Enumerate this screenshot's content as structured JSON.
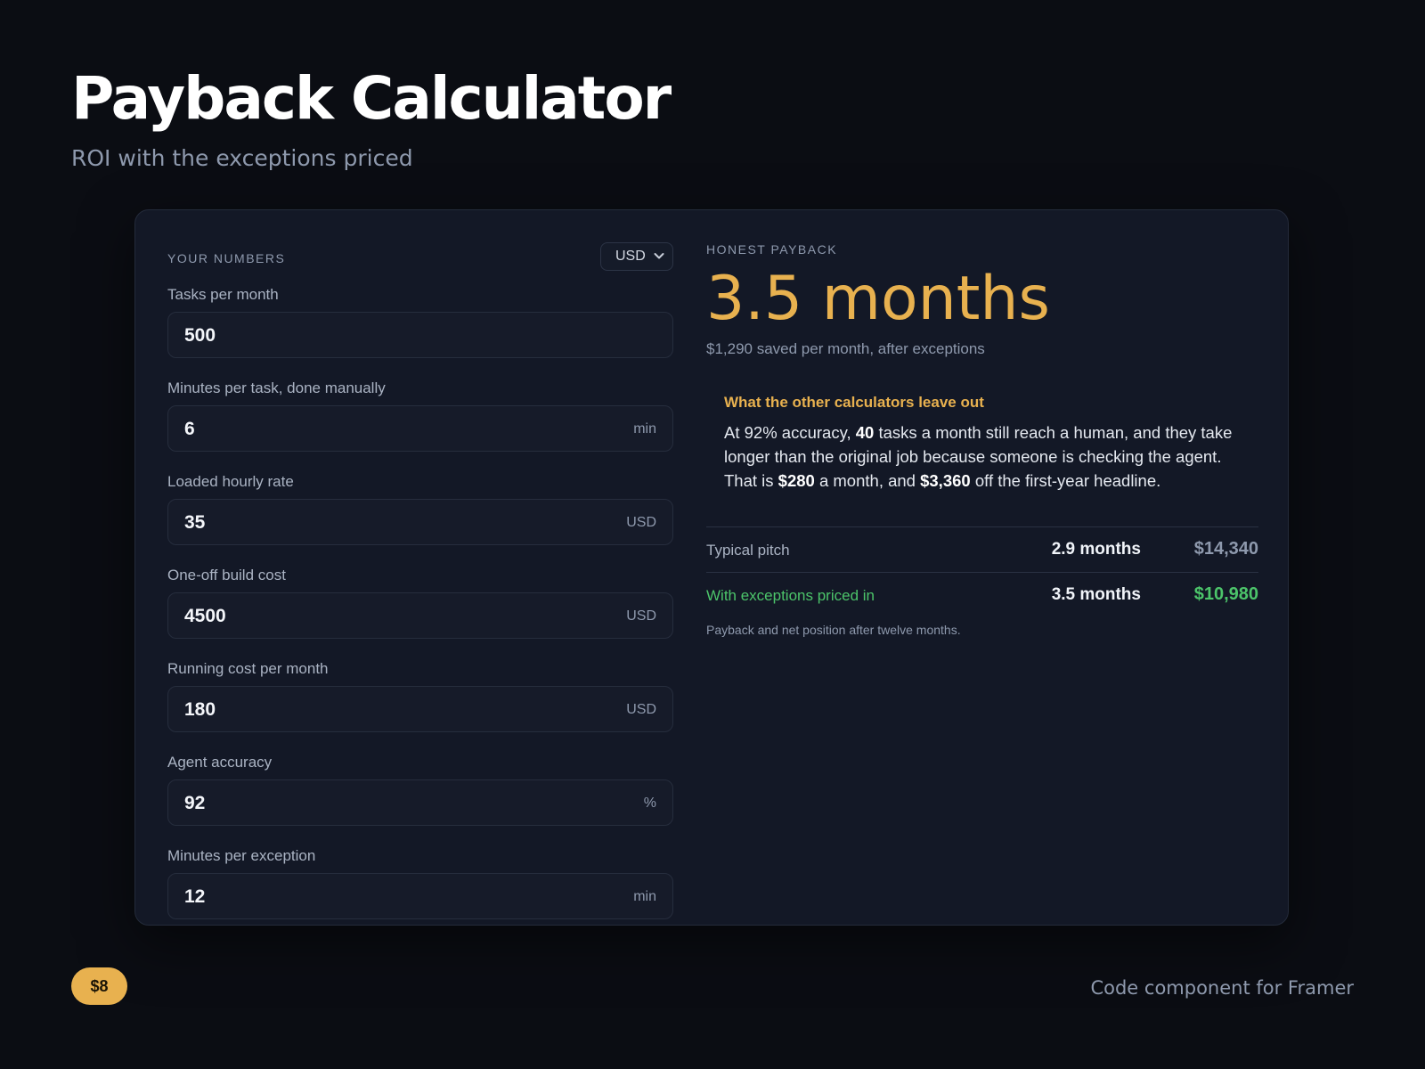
{
  "header": {
    "title": "Payback Calculator",
    "subtitle": "ROI with the exceptions priced"
  },
  "inputs": {
    "section_label": "YOUR NUMBERS",
    "currency": {
      "selected": "USD",
      "icon": "chevron-down-icon"
    },
    "fields": [
      {
        "label": "Tasks per month",
        "value": "500",
        "unit": ""
      },
      {
        "label": "Minutes per task, done manually",
        "value": "6",
        "unit": "min"
      },
      {
        "label": "Loaded hourly rate",
        "value": "35",
        "unit": "USD"
      },
      {
        "label": "One-off build cost",
        "value": "4500",
        "unit": "USD"
      },
      {
        "label": "Running cost per month",
        "value": "180",
        "unit": "USD"
      },
      {
        "label": "Agent accuracy",
        "value": "92",
        "unit": "%"
      },
      {
        "label": "Minutes per exception",
        "value": "12",
        "unit": "min"
      }
    ]
  },
  "result": {
    "section_label": "HONEST PAYBACK",
    "payback": "3.5 months",
    "saved_line": "$1,290 saved per month, after exceptions",
    "callout": {
      "title": "What the other calculators leave out",
      "text_1": "At 92% accuracy, ",
      "exceptions_count": "40",
      "text_2": " tasks a month still reach a human, and they take longer than the original job because someone is checking the agent. That is ",
      "monthly_cost": "$280",
      "text_3": " a month, and ",
      "yearly_cost": "$3,360",
      "text_4": " off the first-year headline."
    },
    "comparison": [
      {
        "label": "Typical pitch",
        "months": "2.9 months",
        "net": "$14,340"
      },
      {
        "label": "With exceptions priced in",
        "months": "3.5 months",
        "net": "$10,980"
      }
    ],
    "note": "Payback and net position after twelve months."
  },
  "footer": {
    "price": "$8",
    "note": "Code component for Framer"
  },
  "colors": {
    "accent": "#e8b14f",
    "positive": "#4cc46a",
    "background": "#0b0d13",
    "card": "#131826"
  }
}
